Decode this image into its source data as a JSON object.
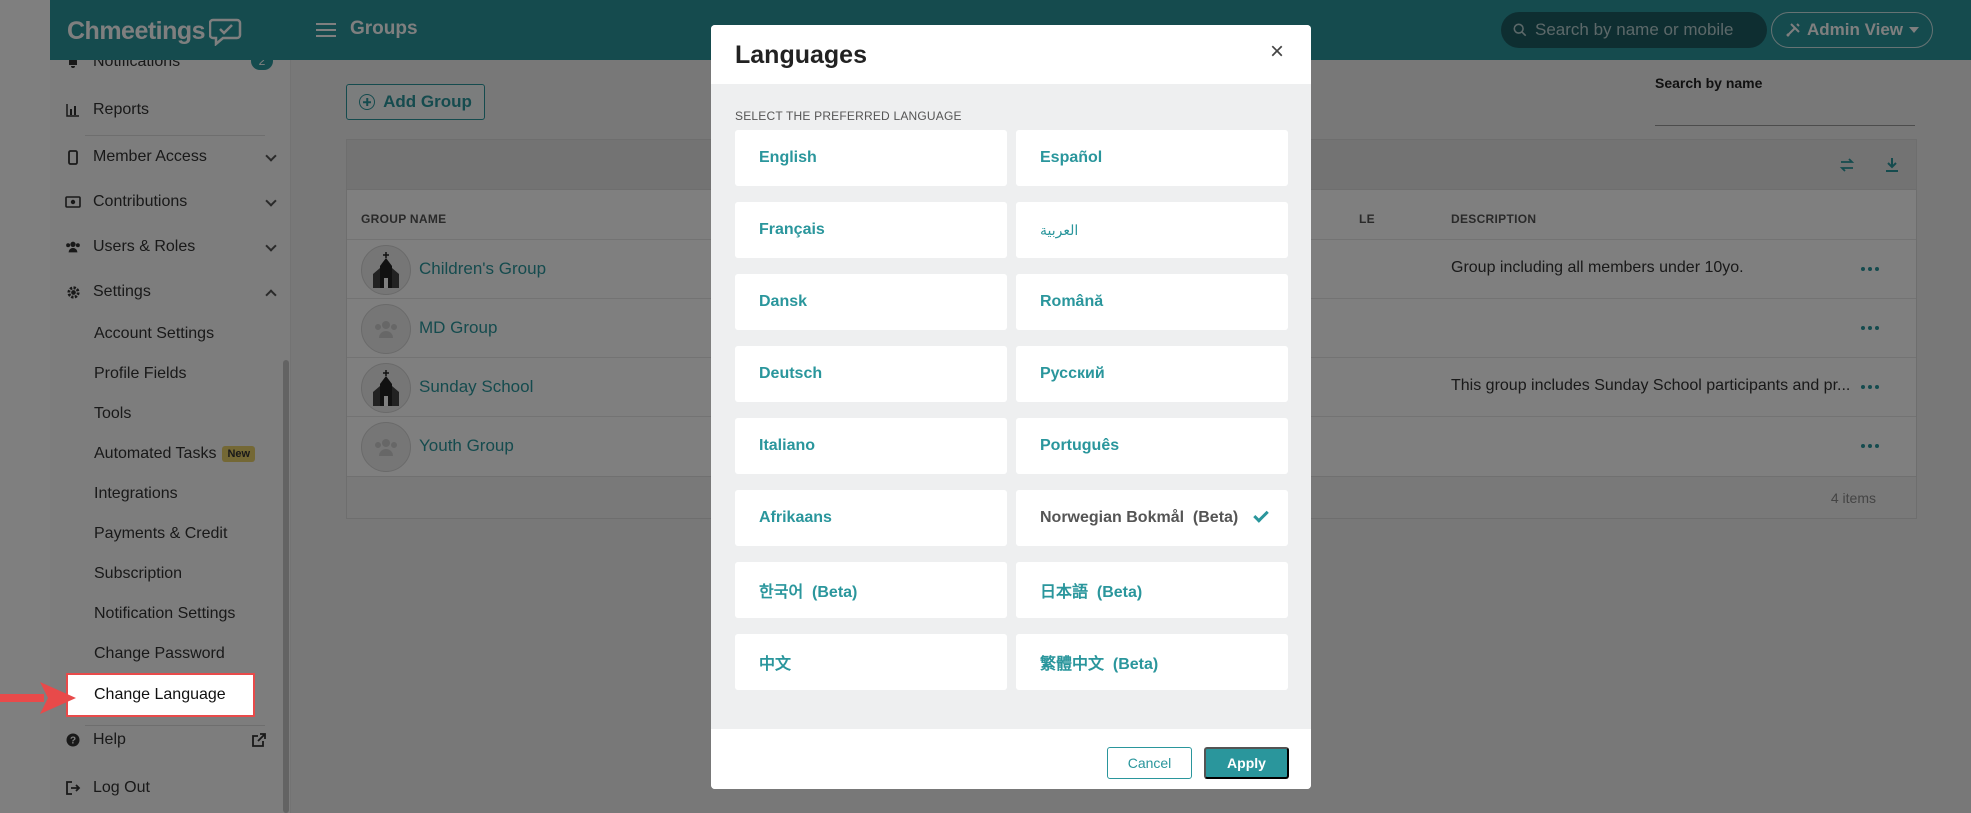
{
  "app": {
    "logo_text": "Chmeetings",
    "page_title": "Groups",
    "search_placeholder": "Search by name or mobile",
    "admin_view_label": "Admin View"
  },
  "sidebar": {
    "notifications_label": "Notifications",
    "notifications_count": "2",
    "reports_label": "Reports",
    "member_access_label": "Member Access",
    "contributions_label": "Contributions",
    "users_roles_label": "Users & Roles",
    "settings_label": "Settings",
    "settings_items": [
      "Account Settings",
      "Profile Fields",
      "Tools",
      "Automated Tasks",
      "Integrations",
      "Payments & Credit",
      "Subscription",
      "Notification Settings",
      "Change Password",
      "Change Language"
    ],
    "new_badge": "New",
    "help_label": "Help",
    "logout_label": "Log Out"
  },
  "main": {
    "add_group_label": "Add Group",
    "search_by_name_label": "Search by name",
    "columns": {
      "group_name": "GROUP NAME",
      "role_partial": "LE",
      "description": "DESCRIPTION"
    },
    "rows": [
      {
        "name": "Children's Group",
        "description": "Group including all members under 10yo.",
        "avatar": "church-icon"
      },
      {
        "name": "MD Group",
        "description": "",
        "avatar": "people-icon"
      },
      {
        "name": "Sunday School",
        "description": "This group includes Sunday School participants and pr...",
        "avatar": "church-icon"
      },
      {
        "name": "Youth Group",
        "description": "",
        "avatar": "people-icon"
      }
    ],
    "items_count": "4 items"
  },
  "modal": {
    "title": "Languages",
    "close_glyph": "×",
    "select_label": "SELECT THE PREFERRED LANGUAGE",
    "languages": [
      {
        "label": "English",
        "selected": false
      },
      {
        "label": "Español",
        "selected": false
      },
      {
        "label": "Français",
        "selected": false
      },
      {
        "label": "العربية",
        "selected": false
      },
      {
        "label": "Dansk",
        "selected": false
      },
      {
        "label": "Română",
        "selected": false
      },
      {
        "label": "Deutsch",
        "selected": false
      },
      {
        "label": "Русский",
        "selected": false
      },
      {
        "label": "Italiano",
        "selected": false
      },
      {
        "label": "Português",
        "selected": false
      },
      {
        "label": "Afrikaans",
        "selected": false
      },
      {
        "label": "Norwegian Bokmål  (Beta)",
        "selected": true
      },
      {
        "label": "한국어  (Beta)",
        "selected": false
      },
      {
        "label": "日本語  (Beta)",
        "selected": false
      },
      {
        "label": "中文",
        "selected": false
      },
      {
        "label": "繁體中文  (Beta)",
        "selected": false
      }
    ],
    "cancel_label": "Cancel",
    "apply_label": "Apply"
  },
  "colors": {
    "brand": "#2a969c",
    "annotation_red": "#e84a4a"
  }
}
